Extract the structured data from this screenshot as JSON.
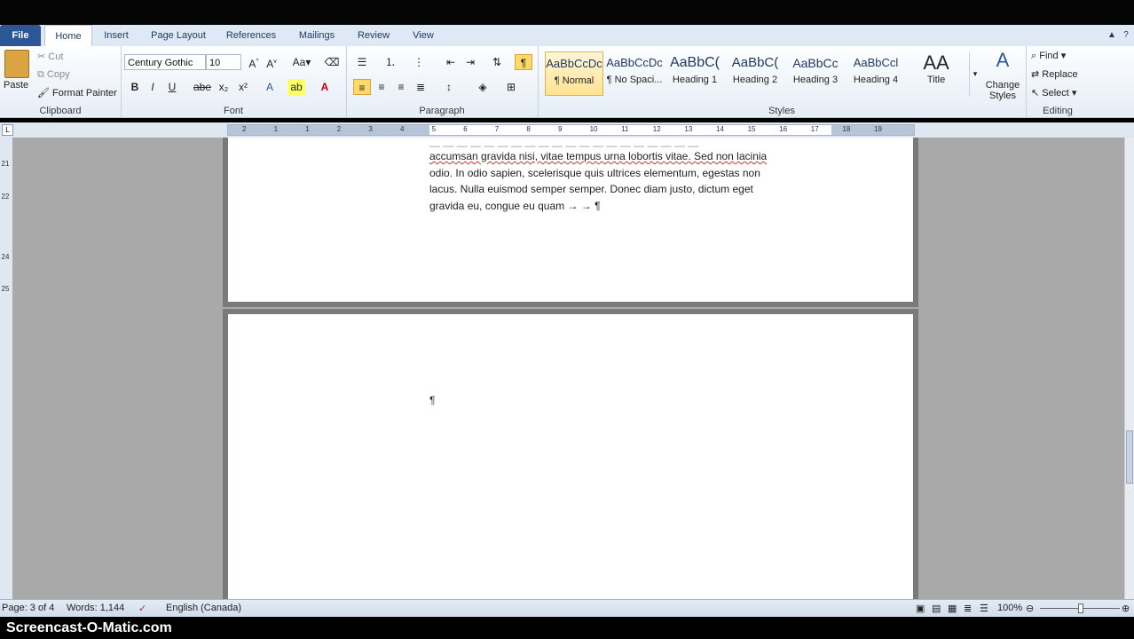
{
  "tabs": [
    {
      "label": "File"
    },
    {
      "label": "Home"
    },
    {
      "label": "Insert"
    },
    {
      "label": "Page Layout"
    },
    {
      "label": "References"
    },
    {
      "label": "Mailings"
    },
    {
      "label": "Review"
    },
    {
      "label": "View"
    }
  ],
  "clipboard": {
    "paste": "Paste",
    "cut": "Cut",
    "copy": "Copy",
    "format_painter": "Format Painter",
    "label": "Clipboard"
  },
  "font": {
    "name": "Century Gothic",
    "size": "10",
    "label": "Font"
  },
  "paragraph": {
    "label": "Paragraph"
  },
  "styles": {
    "label": "Styles",
    "items": [
      {
        "preview": "AaBbCcDc",
        "name": "¶ Normal"
      },
      {
        "preview": "AaBbCcDc",
        "name": "¶ No Spaci..."
      },
      {
        "preview": "AaBbC(",
        "name": "Heading 1"
      },
      {
        "preview": "AaBbC(",
        "name": "Heading 2"
      },
      {
        "preview": "AaBbCc",
        "name": "Heading 3"
      },
      {
        "preview": "AaBbCcl",
        "name": "Heading 4"
      },
      {
        "preview": "AA",
        "name": "Title"
      }
    ],
    "change_styles": "Change Styles"
  },
  "editing": {
    "find": "Find",
    "replace": "Replace",
    "select": "Select",
    "label": "Editing"
  },
  "ruler": {
    "marks": [
      "2",
      "1",
      "1",
      "2",
      "3",
      "4",
      "5",
      "6",
      "7",
      "8",
      "9",
      "10",
      "11",
      "12",
      "13",
      "14",
      "15",
      "16",
      "17",
      "18",
      "19"
    ]
  },
  "vruler": {
    "marks": [
      "21",
      "22",
      "24",
      "25"
    ]
  },
  "document": {
    "lines": [
      "accumsan gravida nisi, vitae tempus urna lobortis vitae. Sed non lacinia",
      "odio. In odio sapien, scelerisque quis ultrices elementum, egestas non",
      "lacus. Nulla euismod semper semper. Donec diam justo, dictum eget",
      "gravida eu, congue eu quam"
    ],
    "line_end_marks": "→      →   ¶",
    "empty_para": "¶"
  },
  "status": {
    "page": "Page: 3 of 4",
    "words": "Words: 1,144",
    "language": "English (Canada)",
    "zoom": "100%"
  },
  "brand": "Screencast-O-Matic.com"
}
